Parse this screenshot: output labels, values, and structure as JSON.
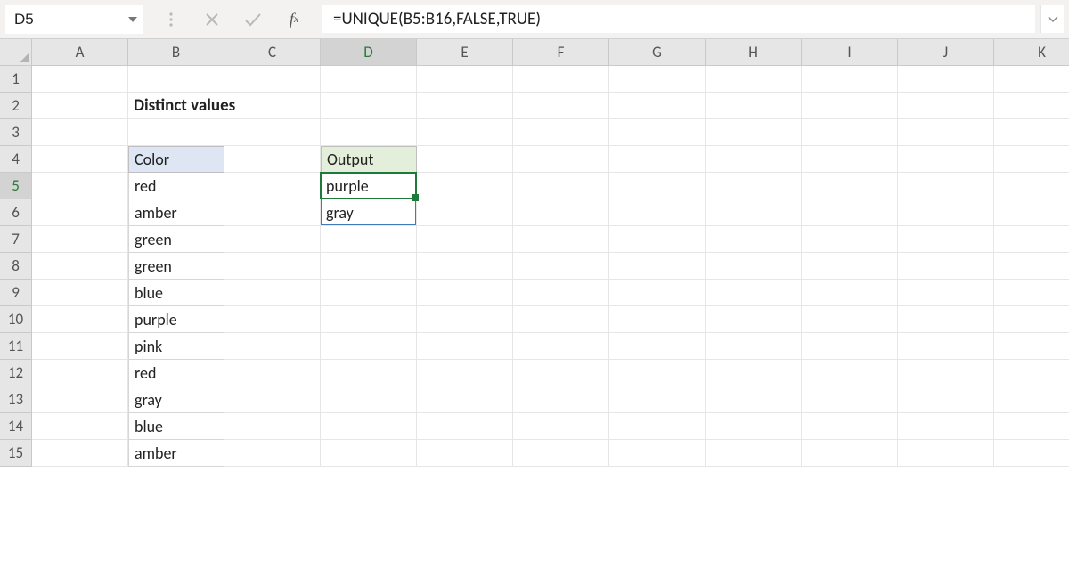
{
  "name_box": "D5",
  "formula": "=UNIQUE(B5:B16,FALSE,TRUE)",
  "columns": [
    "A",
    "B",
    "C",
    "D",
    "E",
    "F",
    "G",
    "H",
    "I",
    "J",
    "K"
  ],
  "rows": [
    "1",
    "2",
    "3",
    "4",
    "5",
    "6",
    "7",
    "8",
    "9",
    "10",
    "11",
    "12",
    "13",
    "14",
    "15"
  ],
  "title": "Distinct values",
  "headers": {
    "color": "Color",
    "output": "Output"
  },
  "color_values": [
    "red",
    "amber",
    "green",
    "green",
    "blue",
    "purple",
    "pink",
    "red",
    "gray",
    "blue",
    "amber"
  ],
  "output_values": [
    "purple",
    "gray"
  ],
  "active_col": "D",
  "active_row": "5"
}
